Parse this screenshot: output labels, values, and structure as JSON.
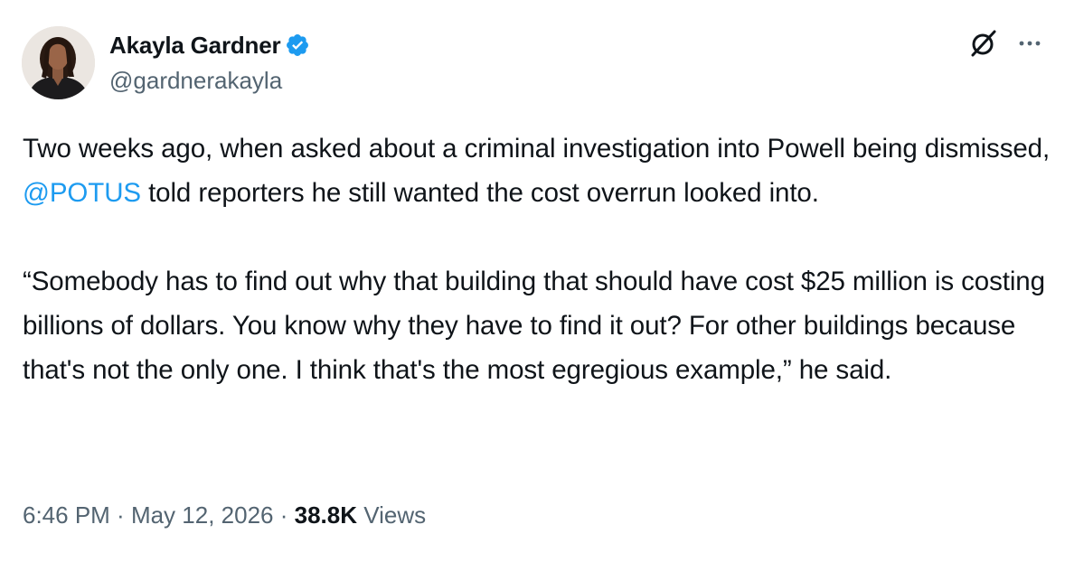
{
  "author": {
    "display_name": "Akayla Gardner",
    "handle": "@gardnerakayla",
    "verified": true,
    "verified_color": "#1d9bf0"
  },
  "tweet": {
    "para1_before": "Two weeks ago, when asked about a criminal investigation into Powell being dismissed, ",
    "mention": "@POTUS",
    "para1_after": " told reporters he still wanted the cost overrun looked into.",
    "para2": "“Somebody has to find out why that building that should have cost $25 million is costing billions of dollars. You know why they have to find it out? For other buildings because that's not the only one. I think that's the most egregious example,” he said."
  },
  "meta": {
    "time": "6:46 PM",
    "sep1": " · ",
    "date": "May 12, 2026",
    "sep2": " · ",
    "views_count": "38.8K",
    "views_label": " Views"
  },
  "icons": {
    "grok": "grok-icon",
    "more": "more-icon",
    "verified": "verified-badge-icon"
  },
  "colors": {
    "text": "#0f1419",
    "secondary": "#536471",
    "link": "#1d9bf0"
  }
}
